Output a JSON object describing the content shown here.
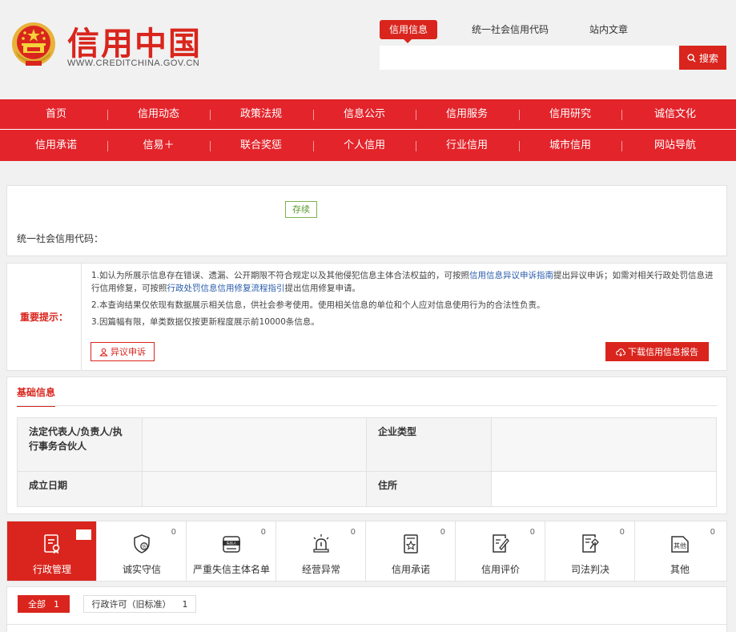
{
  "header": {
    "logo_title": "信用中国",
    "logo_url": "WWW.CREDITCHINA.GOV.CN",
    "search_tabs": [
      "信用信息",
      "统一社会信用代码",
      "站内文章"
    ],
    "search_placeholder": "",
    "search_button": "搜索"
  },
  "nav": {
    "row1": [
      "首页",
      "信用动态",
      "政策法规",
      "信息公示",
      "信用服务",
      "信用研究",
      "诚信文化"
    ],
    "row2": [
      "信用承诺",
      "信易＋",
      "联合奖惩",
      "个人信用",
      "行业信用",
      "城市信用",
      "网站导航"
    ]
  },
  "entity": {
    "status_badge": "存续",
    "credit_code_label": "统一社会信用代码："
  },
  "notice": {
    "title": "重要提示：",
    "p1_a": "1.如认为所展示信息存在错误、遗漏、公开期限不符合规定以及其他侵犯信息主体合法权益的，可按照",
    "p1_link1": "信用信息异议申诉指南",
    "p1_b": "提出异议申诉；如需对相关行政处罚信息进行信用修复，可按照",
    "p1_link2": "行政处罚信息信用修复流程指引",
    "p1_c": "提出信用修复申请。",
    "p2": "2.本查询结果仅依现有数据展示相关信息，供社会参考使用。使用相关信息的单位和个人应对信息使用行为的合法性负责。",
    "p3": "3.因篇幅有限，单类数据仅按更新程度展示前10000条信息。",
    "objection_button": "异议申诉",
    "download_button": "下载信用信息报告"
  },
  "basic": {
    "title": "基础信息",
    "legal_rep_label": "法定代表人/负责人/执行事务合伙人",
    "company_type_label": "企业类型",
    "established_label": "成立日期",
    "address_label": "住所"
  },
  "categories": [
    {
      "label": "行政管理",
      "count": "",
      "icon": "admin-doc-icon"
    },
    {
      "label": "诚实守信",
      "count": "0",
      "icon": "shield-credit-icon"
    },
    {
      "label": "严重失信主体名单",
      "count": "0",
      "icon": "blacklist-icon"
    },
    {
      "label": "经营异常",
      "count": "0",
      "icon": "alarm-icon"
    },
    {
      "label": "信用承诺",
      "count": "0",
      "icon": "commitment-icon"
    },
    {
      "label": "信用评价",
      "count": "0",
      "icon": "evaluation-icon"
    },
    {
      "label": "司法判决",
      "count": "0",
      "icon": "judgment-icon"
    },
    {
      "label": "其他",
      "count": "0",
      "icon": "other-icon"
    }
  ],
  "blacklist_icon_text": "失信人",
  "other_icon_text": "其他",
  "filters": {
    "all_label": "全部",
    "all_count": "1",
    "permit_label": "行政许可（旧标准）",
    "permit_count": "1"
  },
  "colors": {
    "brand_red": "#d9251d",
    "nav_red": "#e3242b",
    "link_blue": "#2a5caa",
    "status_green": "#5a9a2c"
  }
}
